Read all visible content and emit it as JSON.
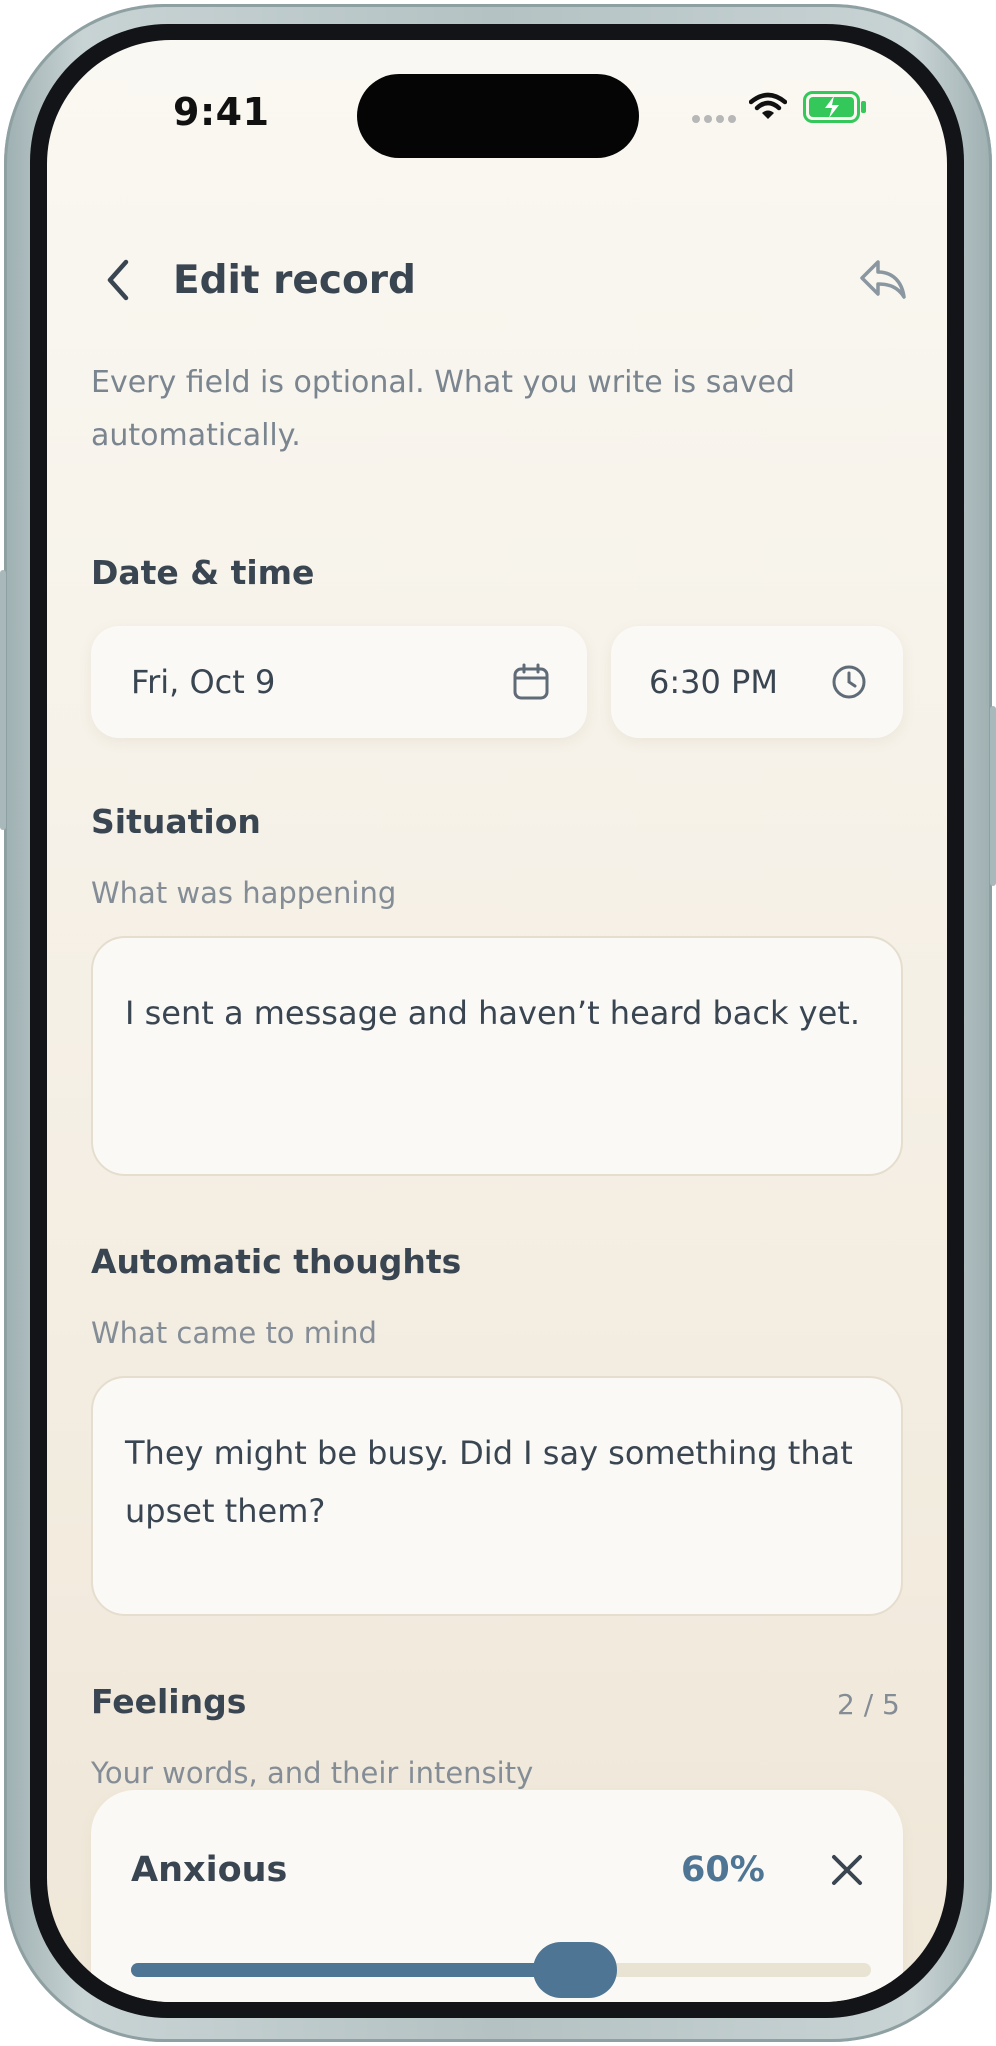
{
  "status_bar": {
    "time": "9:41",
    "icons": [
      "cellular-signal-icon",
      "wifi-icon",
      "battery-charging-icon"
    ]
  },
  "header": {
    "title": "Edit record",
    "back_icon": "chevron-left-icon",
    "share_icon": "reply-share-icon"
  },
  "intro": "Every field is optional. What you write is saved automatically.",
  "date_time": {
    "label": "Date & time",
    "date_value": "Fri, Oct 9",
    "time_value": "6:30 PM",
    "date_icon": "calendar-icon",
    "time_icon": "clock-icon"
  },
  "situation": {
    "label": "Situation",
    "sublabel": "What was happening",
    "value": "I sent a message and haven’t heard back yet."
  },
  "thoughts": {
    "label": "Automatic thoughts",
    "sublabel": "What came to mind",
    "value": "They might be busy. Did I say something that upset them?"
  },
  "feelings": {
    "label": "Feelings",
    "sublabel": "Your words, and their intensity",
    "count": "2 / 5",
    "items": [
      {
        "name": "Anxious",
        "intensity_label": "60%",
        "intensity": 0.6
      }
    ]
  },
  "colors": {
    "accent": "#4f7595",
    "text_primary": "#3a4552",
    "text_secondary": "#848d96",
    "background": "#f6f1e7",
    "battery_green": "#34c759"
  }
}
